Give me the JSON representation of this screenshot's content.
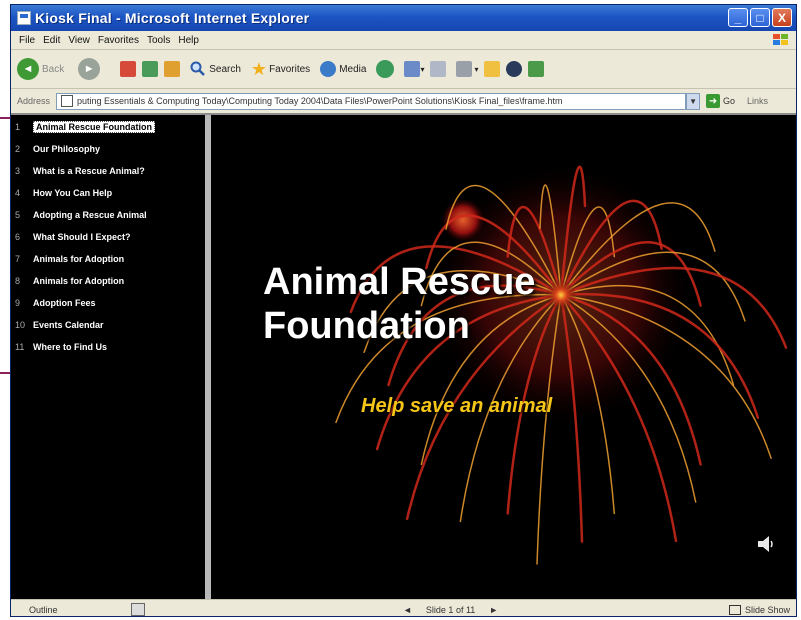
{
  "window": {
    "title": "Kiosk Final - Microsoft Internet Explorer",
    "controls": [
      "_",
      "□",
      "X"
    ]
  },
  "menu": [
    "File",
    "Edit",
    "View",
    "Favorites",
    "Tools",
    "Help"
  ],
  "toolbar": {
    "back_label": "Back",
    "search_label": "Search",
    "favorites_label": "Favorites",
    "media_label": "Media"
  },
  "address": {
    "label": "Address",
    "value": "puting Essentials & Computing Today\\Computing Today 2004\\Data Files\\PowerPoint Solutions\\Kiosk Final_files\\frame.htm",
    "go_label": "Go",
    "links_label": "Links"
  },
  "outline": {
    "items": [
      {
        "num": "1",
        "label": "Animal Rescue Foundation"
      },
      {
        "num": "2",
        "label": "Our Philosophy"
      },
      {
        "num": "3",
        "label": "What is a Rescue Animal?"
      },
      {
        "num": "4",
        "label": "How You Can Help"
      },
      {
        "num": "5",
        "label": "Adopting a Rescue Animal"
      },
      {
        "num": "6",
        "label": "What Should I Expect?"
      },
      {
        "num": "7",
        "label": "Animals for Adoption"
      },
      {
        "num": "8",
        "label": "Animals for Adoption"
      },
      {
        "num": "9",
        "label": "Adoption Fees"
      },
      {
        "num": "10",
        "label": "Events Calendar"
      },
      {
        "num": "11",
        "label": "Where to Find Us"
      }
    ]
  },
  "slide": {
    "title_line1": "Animal Rescue",
    "title_line2": "Foundation",
    "subtitle": "Help save an animal"
  },
  "statusbar": {
    "outline_label": "Outline",
    "prev": "◄",
    "slide_counter": "Slide 1 of 11",
    "next": "►",
    "slideshow_label": "Slide Show"
  },
  "colors": {
    "titlebar": "#1c55c4",
    "subtitle": "#f5c518",
    "firework": "#d0281a",
    "callout": "#8b1f5a"
  }
}
